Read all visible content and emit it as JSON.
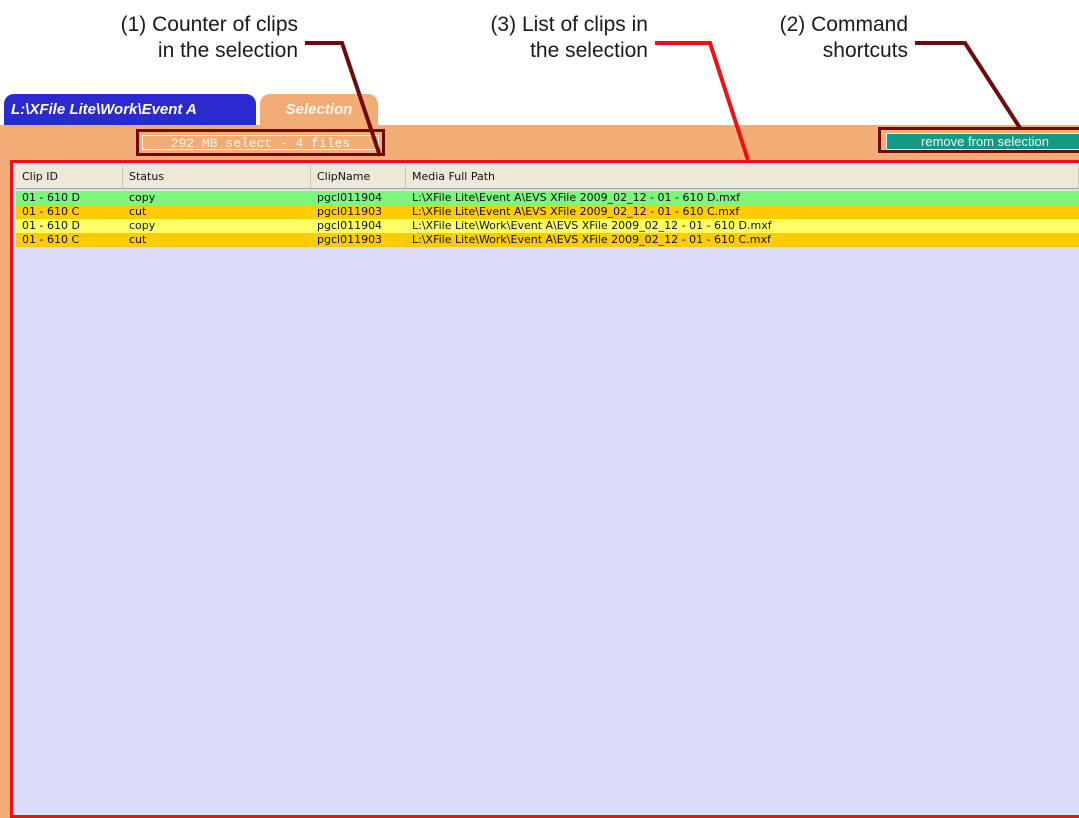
{
  "annotations": {
    "counter": {
      "line1": "(1) Counter of clips",
      "line2": "in the selection"
    },
    "list": {
      "line1": "(3) List of clips in",
      "line2": "the selection"
    },
    "commands": {
      "line1": "(2) Command",
      "line2": "shortcuts"
    },
    "leader_colors": {
      "counter": "#6e0a0a",
      "list": "#ee1111",
      "commands": "#6e0a0a"
    }
  },
  "tabs": [
    {
      "label": "L:\\XFile Lite\\Work\\Event A",
      "color": "#2a2ad0"
    },
    {
      "label": "Selection",
      "color": "#f2ad77"
    }
  ],
  "counter": {
    "text": "292 MB select - 4 files"
  },
  "command": {
    "label": "remove from selection",
    "color": "#129a86"
  },
  "grid": {
    "columns": [
      "Clip ID",
      "Status",
      "ClipName",
      "Media Full Path"
    ],
    "rows": [
      {
        "clip_id": "01 - 610 D",
        "status": "copy",
        "clip_name": "pgcl011904",
        "path": "L:\\XFile Lite\\Event A\\EVS XFile 2009_02_12 - 01 - 610 D.mxf",
        "color": "#7cf77c"
      },
      {
        "clip_id": "01 - 610 C",
        "status": "cut",
        "clip_name": "pgcl011903",
        "path": "L:\\XFile Lite\\Event A\\EVS XFile 2009_02_12 - 01 - 610 C.mxf",
        "color": "#ffcc00"
      },
      {
        "clip_id": "01 - 610 D",
        "status": "copy",
        "clip_name": "pgcl011904",
        "path": "L:\\XFile Lite\\Work\\Event A\\EVS XFile 2009_02_12 - 01 - 610 D.mxf",
        "color": "#ffff66"
      },
      {
        "clip_id": "01 - 610 C",
        "status": "cut",
        "clip_name": "pgcl011903",
        "path": "L:\\XFile Lite\\Work\\Event A\\EVS XFile 2009_02_12 - 01 - 610 C.mxf",
        "color": "#ffcc00"
      }
    ],
    "list_background": "#dcdcfa"
  },
  "panel_color": "#f2ad77"
}
